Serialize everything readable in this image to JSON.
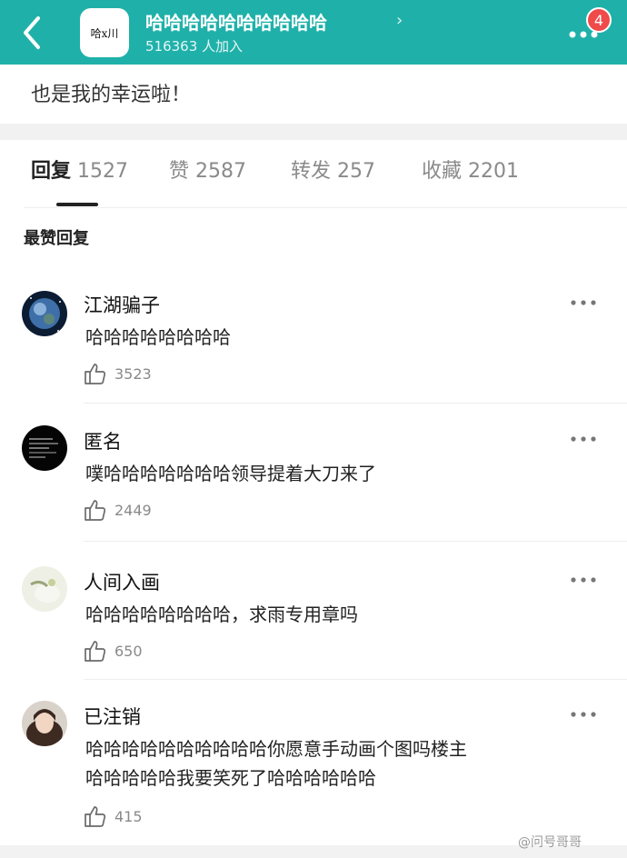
{
  "header": {
    "group_logo_text": "哈x川",
    "group_title": "哈哈哈哈哈哈哈哈哈哈",
    "members": "516363 人加入",
    "badge_count": "4",
    "bg_color": "#1fb1a9"
  },
  "post": {
    "partial_text": "也是我的幸运啦！"
  },
  "tabs": [
    {
      "name": "回复",
      "count": "1527"
    },
    {
      "name": "赞",
      "count": "2587"
    },
    {
      "name": "转发",
      "count": "257"
    },
    {
      "name": "收藏",
      "count": "2201"
    }
  ],
  "section_title": "最赞回复",
  "comments": [
    {
      "name": "江湖骗子",
      "lines": [
        "哈哈哈哈哈哈哈哈"
      ],
      "likes": "3523"
    },
    {
      "name": "匿名",
      "lines": [
        "噗哈哈哈哈哈哈哈领导提着大刀来了"
      ],
      "likes": "2449"
    },
    {
      "name": "人间入画",
      "lines": [
        "哈哈哈哈哈哈哈哈，求雨专用章吗"
      ],
      "likes": "650"
    },
    {
      "name": "已注销",
      "lines": [
        "哈哈哈哈哈哈哈哈哈哈你愿意手动画个图吗楼主",
        "哈哈哈哈哈我要笑死了哈哈哈哈哈哈"
      ],
      "likes": "415"
    }
  ],
  "watermark": "@问号哥哥"
}
